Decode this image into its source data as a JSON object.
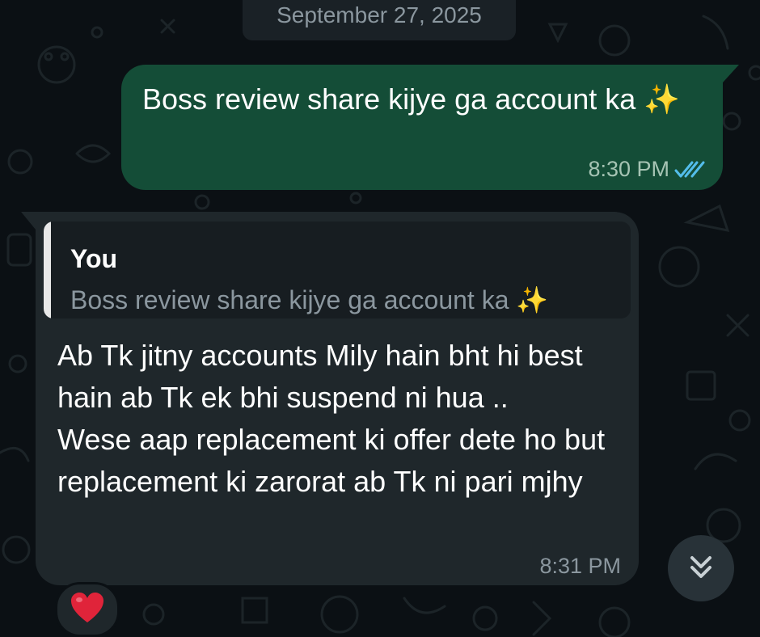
{
  "date_separator": "September 27, 2025",
  "outgoing_message": {
    "text": "Boss review share kijye ga account ka ✨",
    "time": "8:30 PM",
    "status_icon": "double-check-read-icon"
  },
  "incoming_message": {
    "quoted": {
      "author": "You",
      "text": "Boss review share kijye ga account ka ✨"
    },
    "text": "Ab Tk jitny accounts Mily hain bht hi best hain ab Tk ek bhi suspend ni hua ..\nWese aap replacement ki offer dete ho but replacement ki zarorat ab Tk ni pari mjhy",
    "time": "8:31 PM",
    "reaction_icon": "red-heart-icon"
  },
  "scroll_button_icon": "double-chevron-down-icon",
  "colors": {
    "background": "#0b1014",
    "outgoing_bubble": "#144d37",
    "incoming_bubble": "#1f272b",
    "read_ticks": "#53bdeb",
    "heart": "#e0243a"
  }
}
